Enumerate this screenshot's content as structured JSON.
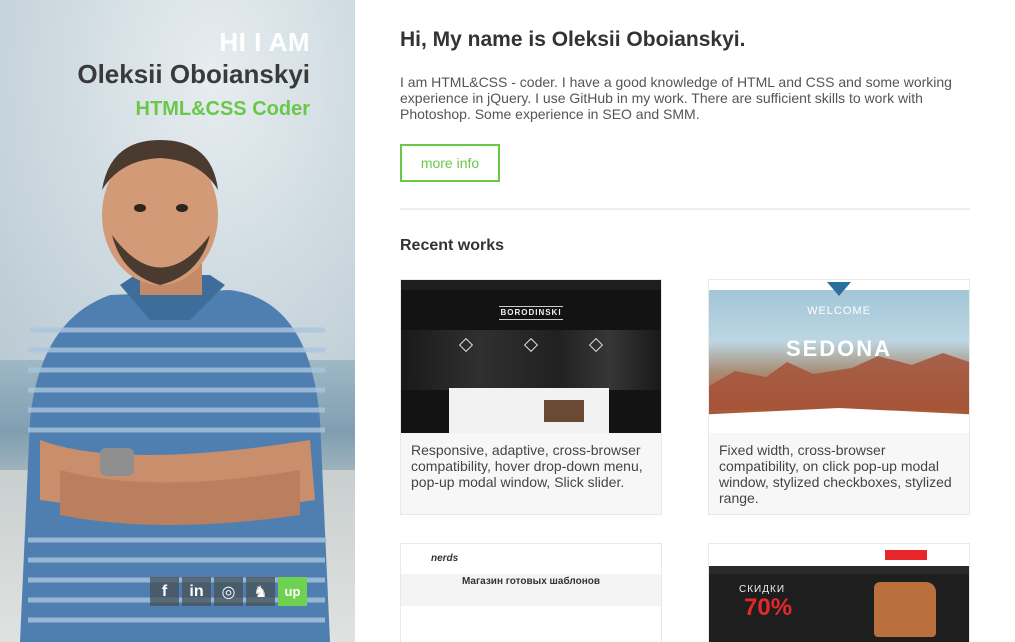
{
  "hero": {
    "hi": "HI I AM",
    "name": "Oleksii Oboianskyi",
    "role": "HTML&CSS Coder",
    "socials": [
      {
        "icon": "facebook-icon",
        "glyph": "f"
      },
      {
        "icon": "linkedin-icon",
        "glyph": "in"
      },
      {
        "icon": "instagram-icon",
        "glyph": "◎"
      },
      {
        "icon": "github-icon",
        "glyph": "♞"
      },
      {
        "icon": "upwork-icon",
        "glyph": "up"
      }
    ]
  },
  "main": {
    "greeting": "Hi, My name is Oleksii Oboianskyi.",
    "about": "I am HTML&CSS - coder. I have a good knowledge of HTML and CSS and some working experience in jQuery. I use GitHub in my work. There are sufficient skills to work with Photoshop. Some experience in SEO and SMM.",
    "more_label": "more info",
    "recent_title": "Recent works"
  },
  "works": [
    {
      "desc": "Responsive, adaptive, cross-browser compatibility, hover drop-down menu, pop-up modal window, Slick slider.",
      "thumb_text": "BORODINSKI"
    },
    {
      "desc": "Fixed width, cross-browser compatibility, on click pop-up modal window, stylized checkboxes, stylized range.",
      "thumb_welcome": "WELCOME",
      "thumb_text": "SEDONA"
    },
    {
      "thumb_logo": "nerds",
      "thumb_text": "Магазин готовых шаблонов"
    },
    {
      "thumb_sale": "СКИДКИ",
      "thumb_pct": "70%"
    }
  ],
  "colors": {
    "accent": "#6ac849",
    "text": "#333333"
  }
}
